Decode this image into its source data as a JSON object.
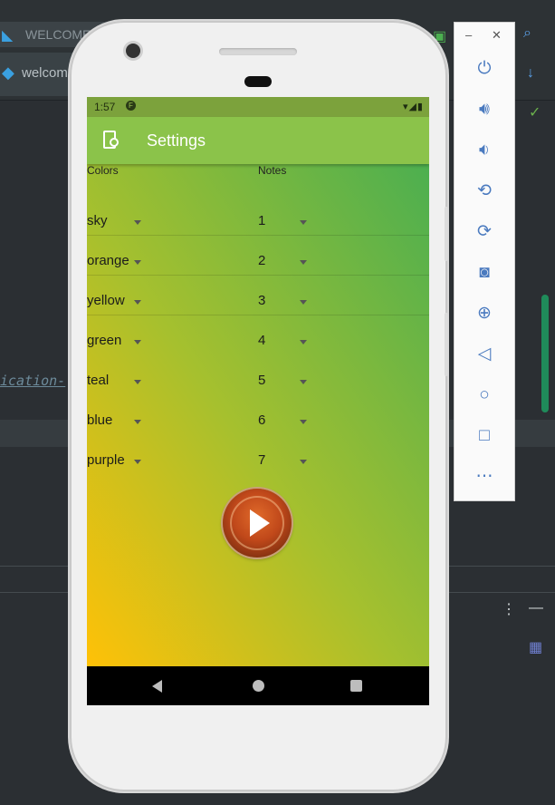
{
  "ide": {
    "tab1_label": "WELCOME",
    "tab2_label": "welcom",
    "code_snippet": "ication-"
  },
  "phone": {
    "status": {
      "time": "1:57"
    },
    "appbar": {
      "title": "Settings"
    },
    "columns": {
      "colors_header": "Colors",
      "notes_header": "Notes"
    },
    "rows": [
      {
        "color": "sky",
        "note": "1"
      },
      {
        "color": "orange",
        "note": "2"
      },
      {
        "color": "yellow",
        "note": "3"
      },
      {
        "color": "green",
        "note": "4"
      },
      {
        "color": "teal",
        "note": "5"
      },
      {
        "color": "blue",
        "note": "6"
      },
      {
        "color": "purple",
        "note": "7"
      }
    ]
  },
  "colors": {
    "appbar": "#8bc34a",
    "gradient_top_right": "#4caf50",
    "gradient_bottom_left": "#ffc107",
    "play_button": "#c0481a"
  },
  "icons": {
    "play": "play-icon",
    "emulator_toolbar": [
      "power-icon",
      "volume-up-icon",
      "volume-down-icon",
      "rotate-left-icon",
      "rotate-right-icon",
      "camera-icon",
      "zoom-icon",
      "back-icon",
      "home-icon",
      "overview-icon",
      "more-icon"
    ]
  }
}
